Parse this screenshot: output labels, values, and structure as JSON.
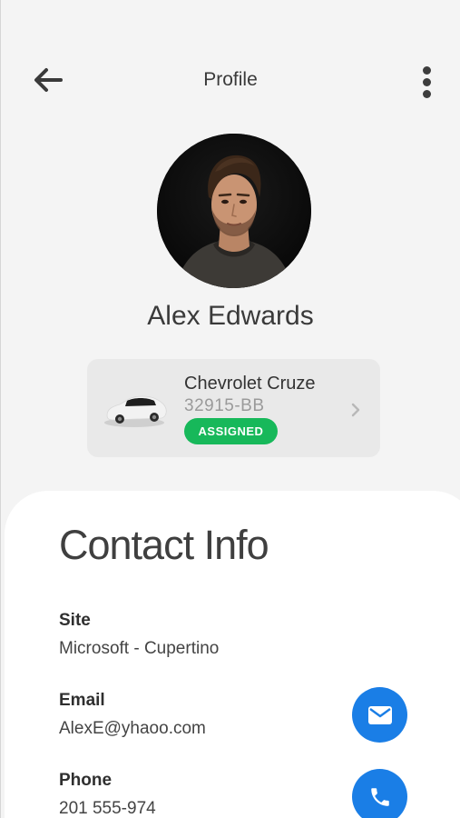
{
  "header": {
    "title": "Profile"
  },
  "profile": {
    "name": "Alex Edwards"
  },
  "vehicle": {
    "name": "Chevrolet Cruze",
    "plate": "32915-BB",
    "status": "ASSIGNED"
  },
  "contact": {
    "title": "Contact Info",
    "site_label": "Site",
    "site_value": "Microsoft - Cupertino",
    "email_label": "Email",
    "email_value": "AlexE@yhaoo.com",
    "phone_label": "Phone",
    "phone_value": "201 555-974"
  },
  "icons": {
    "back": "arrow-left-icon",
    "more": "more-vertical-icon",
    "chevron": "chevron-right-icon",
    "email": "envelope-icon",
    "phone": "phone-icon"
  },
  "colors": {
    "accent": "#1a7ee6",
    "status_assigned": "#17b85a",
    "background": "#f4f4f4",
    "card": "#e9e9e9"
  }
}
